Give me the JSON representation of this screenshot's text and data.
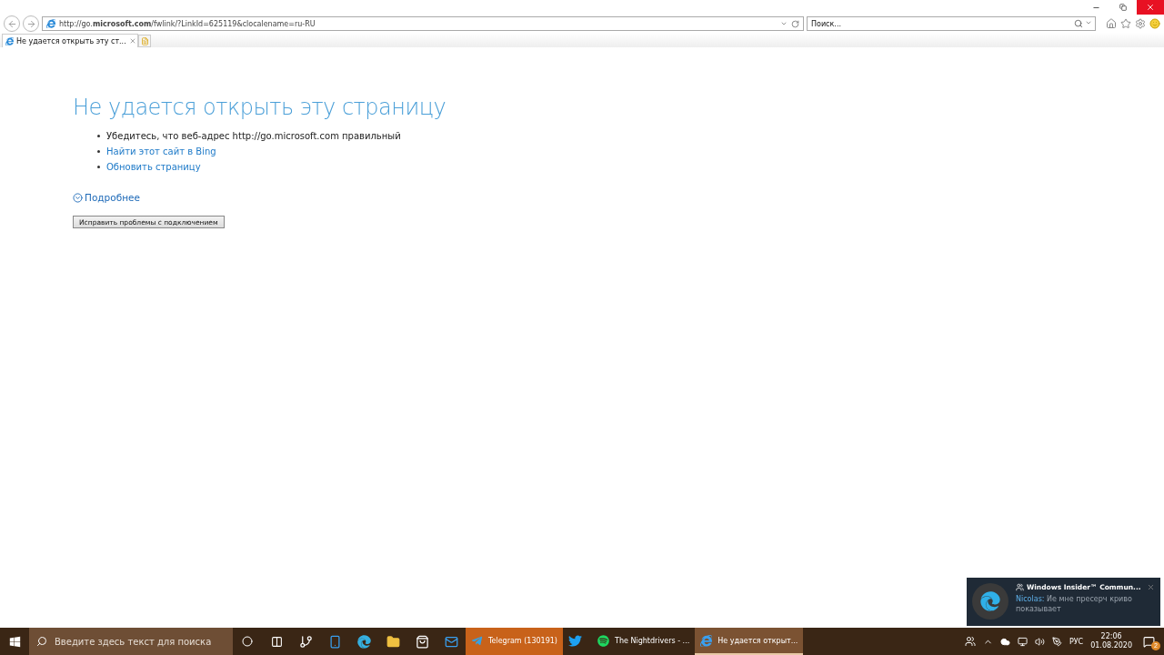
{
  "browser": {
    "address": "http://go.**microsoft.com**/fwlink/?LinkId=625119&clocalename=ru-RU",
    "search": {
      "placeholder": "Поиск..."
    },
    "tabs": [
      {
        "title": "Не удается открыть эту ст...",
        "selected": true
      }
    ]
  },
  "page": {
    "heading": "Не удается открыть эту страницу",
    "bullets": [
      {
        "kind": "text",
        "text": "Убедитесь, что веб-адрес http://go.microsoft.com правильный"
      },
      {
        "kind": "link",
        "text": "Найти этот сайт в Bing"
      },
      {
        "kind": "link",
        "text": "Обновить страницу"
      }
    ],
    "details": {
      "label": "Подробнее",
      "expanded": false
    },
    "button": "Исправить проблемы с подключением"
  },
  "notification": {
    "title": "Windows Insider™ Commun...",
    "sender": "Nicolas:",
    "message": "Ие мне пресерч криво показывает"
  },
  "taskbar": {
    "search": {
      "placeholder": "Введите здесь текст для поиска"
    },
    "pinned": [
      {
        "kind": "cortana"
      },
      {
        "kind": "taskview"
      },
      {
        "kind": "flow"
      },
      {
        "kind": "phone"
      },
      {
        "kind": "edge"
      },
      {
        "kind": "folder"
      },
      {
        "kind": "store"
      },
      {
        "kind": "mail"
      }
    ],
    "apps": [
      {
        "kind": "telegram",
        "label": "Telegram (130191)",
        "selected": false,
        "flashing": true
      },
      {
        "kind": "twitter",
        "selected": false,
        "flashing": false
      },
      {
        "kind": "spotify",
        "label": "The Nightdrivers - ...",
        "selected": false,
        "flashing": false
      },
      {
        "kind": "ie",
        "label": "Не удается открыт...",
        "selected": true,
        "flashing": false
      }
    ],
    "language": "РУС",
    "time": "22:06",
    "date": "01.08.2020",
    "notifications": "2"
  }
}
